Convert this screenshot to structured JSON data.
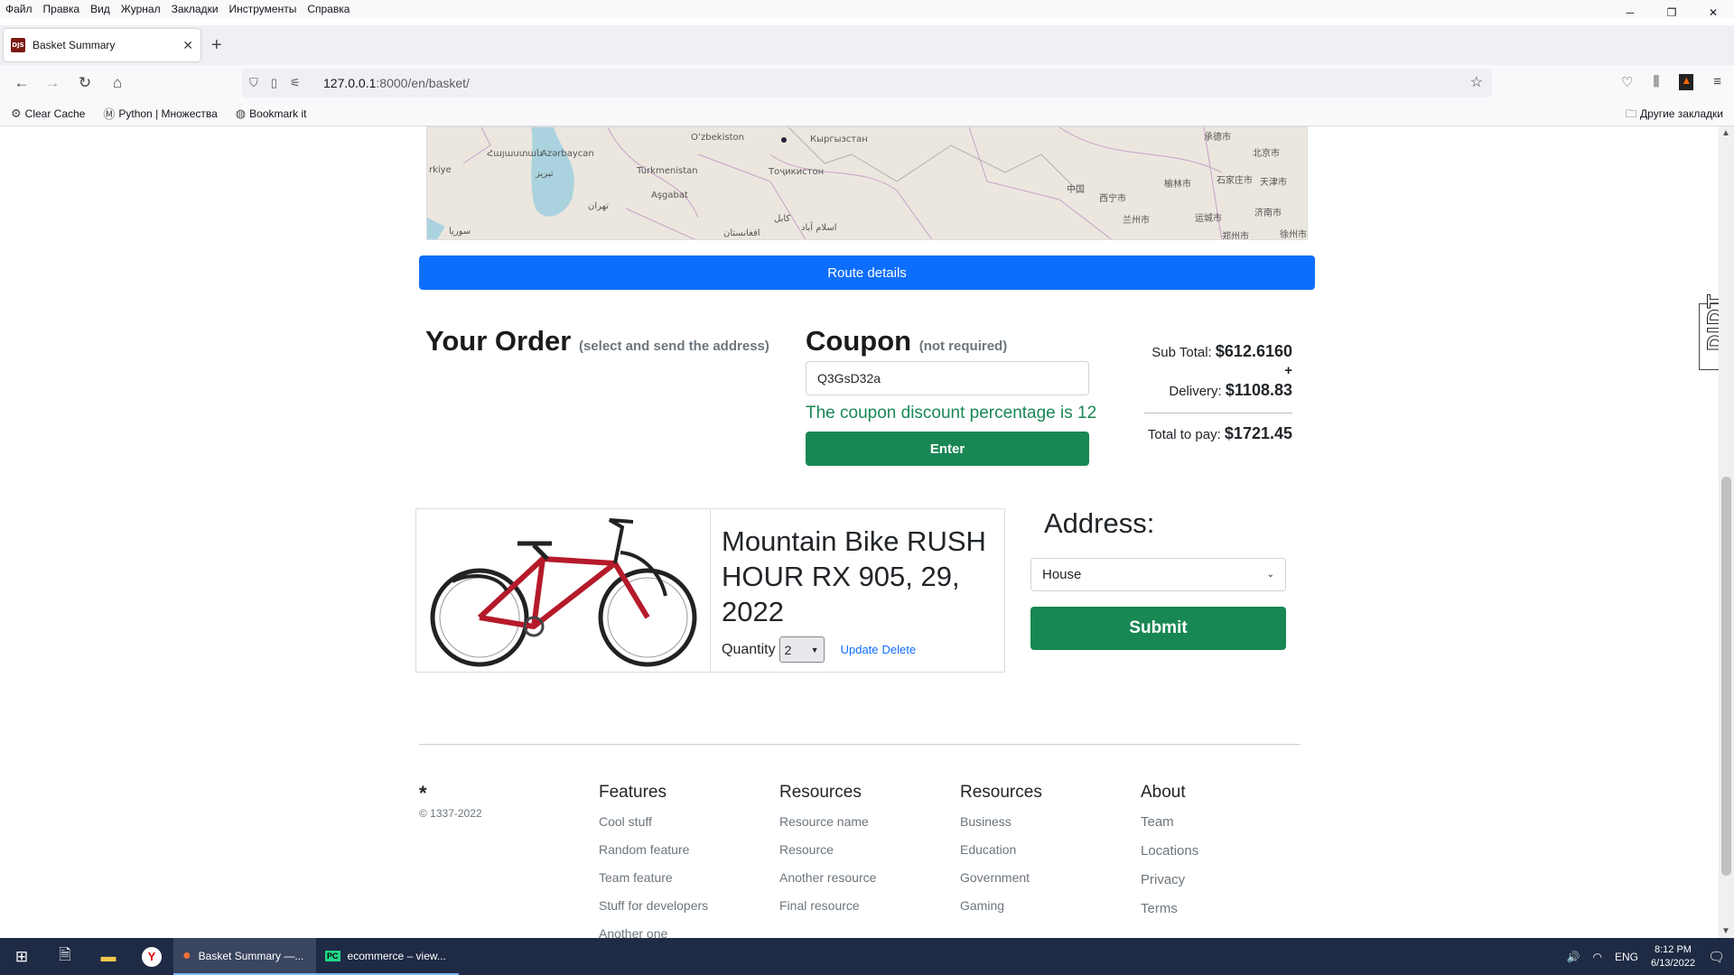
{
  "menu": [
    "Файл",
    "Правка",
    "Вид",
    "Журнал",
    "Закладки",
    "Инструменты",
    "Справка"
  ],
  "tab": {
    "favicon_text": "DJS",
    "title": "Basket Summary",
    "close": "✕",
    "new_tab": "+"
  },
  "url": {
    "host": "127.0.0.1",
    "rest": ":8000/en/basket/"
  },
  "bookmarks": [
    {
      "icon": "gear-icon",
      "label": "Clear Cache"
    },
    {
      "icon": "m-icon",
      "label": "Python | Множества"
    },
    {
      "icon": "globe-icon",
      "label": "Bookmark it"
    }
  ],
  "other_bookmarks": "Другие закладки",
  "map_labels": [
    "Oʻzbekiston",
    "Кыргызстан",
    "Azərbaycan",
    "Türkmenistan",
    "Aşgabat",
    "Тоҷикистон",
    "Հայաստան",
    "rkiye",
    "تبریز",
    "تهران",
    "سوریا",
    "کابل",
    "اسلام آباد",
    "افغانستان",
    "中国",
    "西宁市",
    "兰州市",
    "北京市",
    "天津市",
    "石家庄市",
    "榆林市",
    "济南市",
    "运城市",
    "郑州市",
    "徐州市",
    "承德市"
  ],
  "route_button": "Route details",
  "order": {
    "title": "Your Order",
    "subtitle": "(select and send the address)"
  },
  "coupon": {
    "title": "Coupon",
    "subtitle": "(not required)",
    "value": "Q3GsD32a",
    "message": "The coupon discount percentage is 12",
    "enter": "Enter"
  },
  "totals": {
    "subtotal_label": "Sub Total:",
    "subtotal": "$612.6160",
    "plus": "+",
    "delivery_label": "Delivery:",
    "delivery": "$1108.83",
    "total_label": "Total to pay:",
    "total": "$1721.45"
  },
  "product": {
    "name": "Mountain Bike RUSH HOUR RX 905, 29, 2022",
    "quantity_label": "Quantity",
    "quantity": "2",
    "update": "Update",
    "delete": "Delete"
  },
  "address": {
    "title": "Address:",
    "selected": "House",
    "submit": "Submit"
  },
  "footer": {
    "logo": "*",
    "copyright": "© 1337-2022",
    "columns": [
      {
        "title": "Features",
        "links": [
          "Cool stuff",
          "Random feature",
          "Team feature",
          "Stuff for developers",
          "Another one"
        ]
      },
      {
        "title": "Resources",
        "links": [
          "Resource name",
          "Resource",
          "Another resource",
          "Final resource"
        ]
      },
      {
        "title": "Resources",
        "links": [
          "Business",
          "Education",
          "Government",
          "Gaming"
        ]
      },
      {
        "title": "About",
        "links": [
          "Team",
          "Locations",
          "Privacy",
          "Terms"
        ]
      }
    ]
  },
  "djdt": "DJDT",
  "taskbar": {
    "apps": [
      {
        "label": "Basket Summary —...",
        "icon": "firefox-icon"
      },
      {
        "label": "ecommerce – view...",
        "icon": "pycharm-icon"
      }
    ],
    "lang": "ENG",
    "time": "8:12 PM",
    "date": "6/13/2022"
  },
  "colors": {
    "primary": "#0d6efd",
    "success": "#198754",
    "taskbar": "#1f2a44"
  }
}
